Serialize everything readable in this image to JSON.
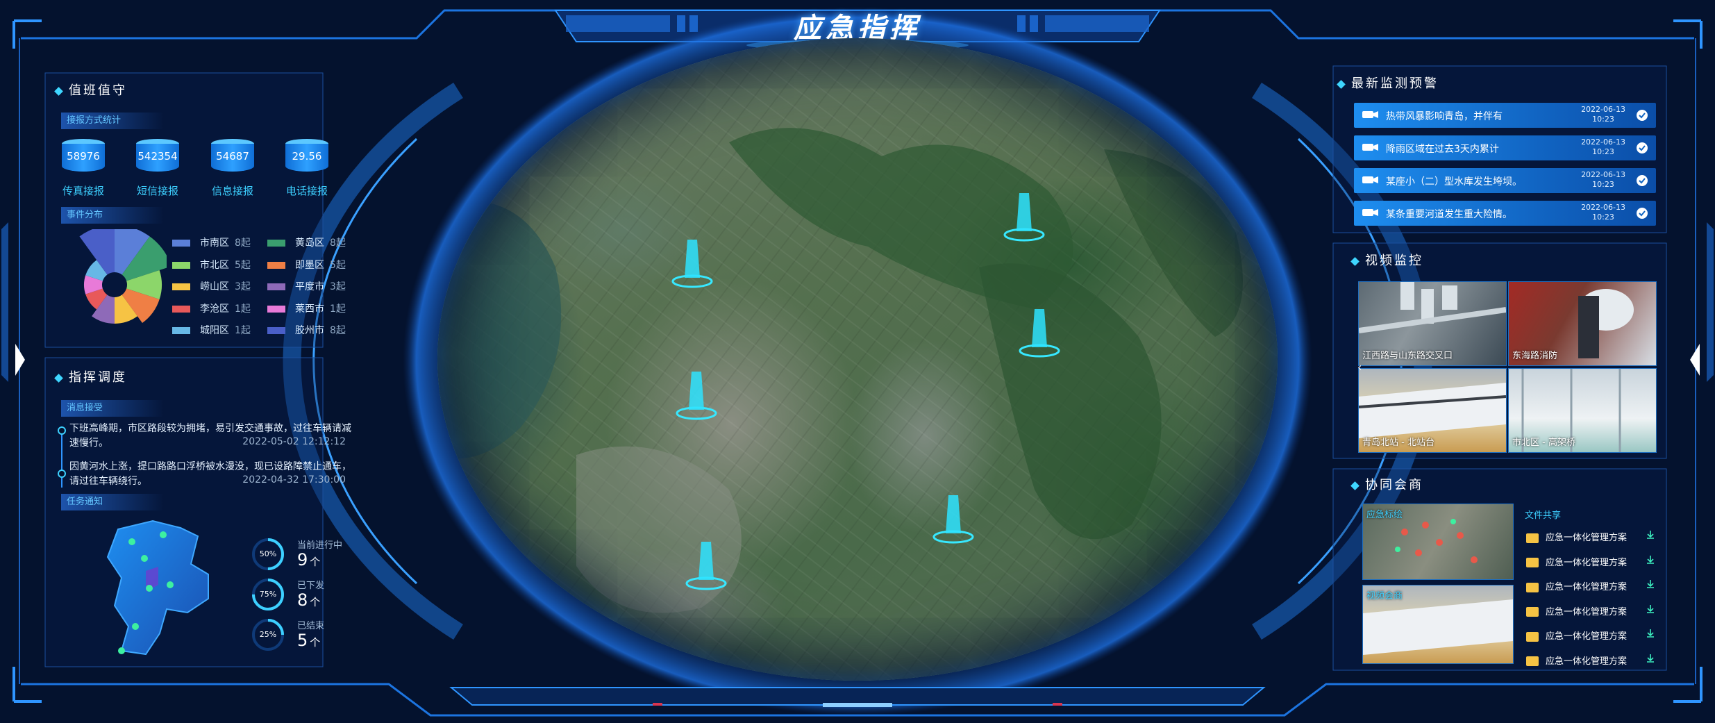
{
  "header": {
    "title": "应急指挥"
  },
  "left": {
    "duty": {
      "title": "值班值守",
      "report_tag": "接报方式统计",
      "stats": [
        {
          "value": "58976",
          "label": "传真接报"
        },
        {
          "value": "542354",
          "label": "短信接报"
        },
        {
          "value": "54687",
          "label": "信息接报"
        },
        {
          "value": "29.56",
          "label": "电话接报"
        }
      ],
      "event_tag": "事件分布",
      "districts": [
        {
          "name": "市南区",
          "count": "8起",
          "color": "#5b7fd8"
        },
        {
          "name": "黄岛区",
          "count": "8起",
          "color": "#3a9e6e"
        },
        {
          "name": "市北区",
          "count": "5起",
          "color": "#8cd66a"
        },
        {
          "name": "即墨区",
          "count": "5起",
          "color": "#ef7f45"
        },
        {
          "name": "崂山区",
          "count": "3起",
          "color": "#f6c344"
        },
        {
          "name": "平度市",
          "count": "3起",
          "color": "#8e6ab8"
        },
        {
          "name": "李沧区",
          "count": "1起",
          "color": "#e8595a"
        },
        {
          "name": "莱西市",
          "count": "1起",
          "color": "#e87ad8"
        },
        {
          "name": "城阳区",
          "count": "1起",
          "color": "#67b8e6"
        },
        {
          "name": "胶州市",
          "count": "8起",
          "color": "#4a5fc8"
        }
      ]
    },
    "command": {
      "title": "指挥调度",
      "msg_tag": "消息接受",
      "messages": [
        {
          "text1": "下班高峰期，市区路段较为拥堵，易引发交通事故，过往车辆请减",
          "text2": "速慢行。",
          "time": "2022-05-02 12:12:12"
        },
        {
          "text1": "因黄河水上涨，提口路路口浮桥被水漫没，现已设路障禁止通车，",
          "text2": "请过往车辆绕行。",
          "time": "2022-04-32 17:30:00"
        }
      ],
      "task_tag": "任务通知",
      "tasks": [
        {
          "pct": "50%",
          "label": "当前进行中",
          "num": "9",
          "unit": "个",
          "fraction": 0.5
        },
        {
          "pct": "75%",
          "label": "已下发",
          "num": "8",
          "unit": "个",
          "fraction": 0.75
        },
        {
          "pct": "25%",
          "label": "已结束",
          "num": "5",
          "unit": "个",
          "fraction": 0.25
        }
      ]
    }
  },
  "right": {
    "alerts": {
      "title": "最新监测预警",
      "items": [
        {
          "text": "热带风暴影响青岛，并伴有",
          "date": "2022-06-13",
          "time": "10:23"
        },
        {
          "text": "降雨区域在过去3天内累计",
          "date": "2022-06-13",
          "time": "10:23"
        },
        {
          "text": "某座小（二）型水库发生垮坝。",
          "date": "2022-06-13",
          "time": "10:23"
        },
        {
          "text": "某条重要河道发生重大险情。",
          "date": "2022-06-13",
          "time": "10:23"
        }
      ]
    },
    "video": {
      "title": "视频监控",
      "feeds": [
        "江西路与山东路交叉口",
        "东海路消防",
        "青岛北站 - 北站台",
        "市北区 - 高架桥"
      ]
    },
    "collab": {
      "title": "协同会商",
      "thumbs": [
        "应急标绘",
        "视频会商"
      ],
      "files_title": "文件共享",
      "files": [
        "应急一体化管理方案",
        "应急一体化管理方案",
        "应急一体化管理方案",
        "应急一体化管理方案",
        "应急一体化管理方案",
        "应急一体化管理方案"
      ]
    }
  },
  "colors": {
    "accent": "#3dd0ff",
    "frame": "#1c74e0",
    "background": "#04122e"
  }
}
